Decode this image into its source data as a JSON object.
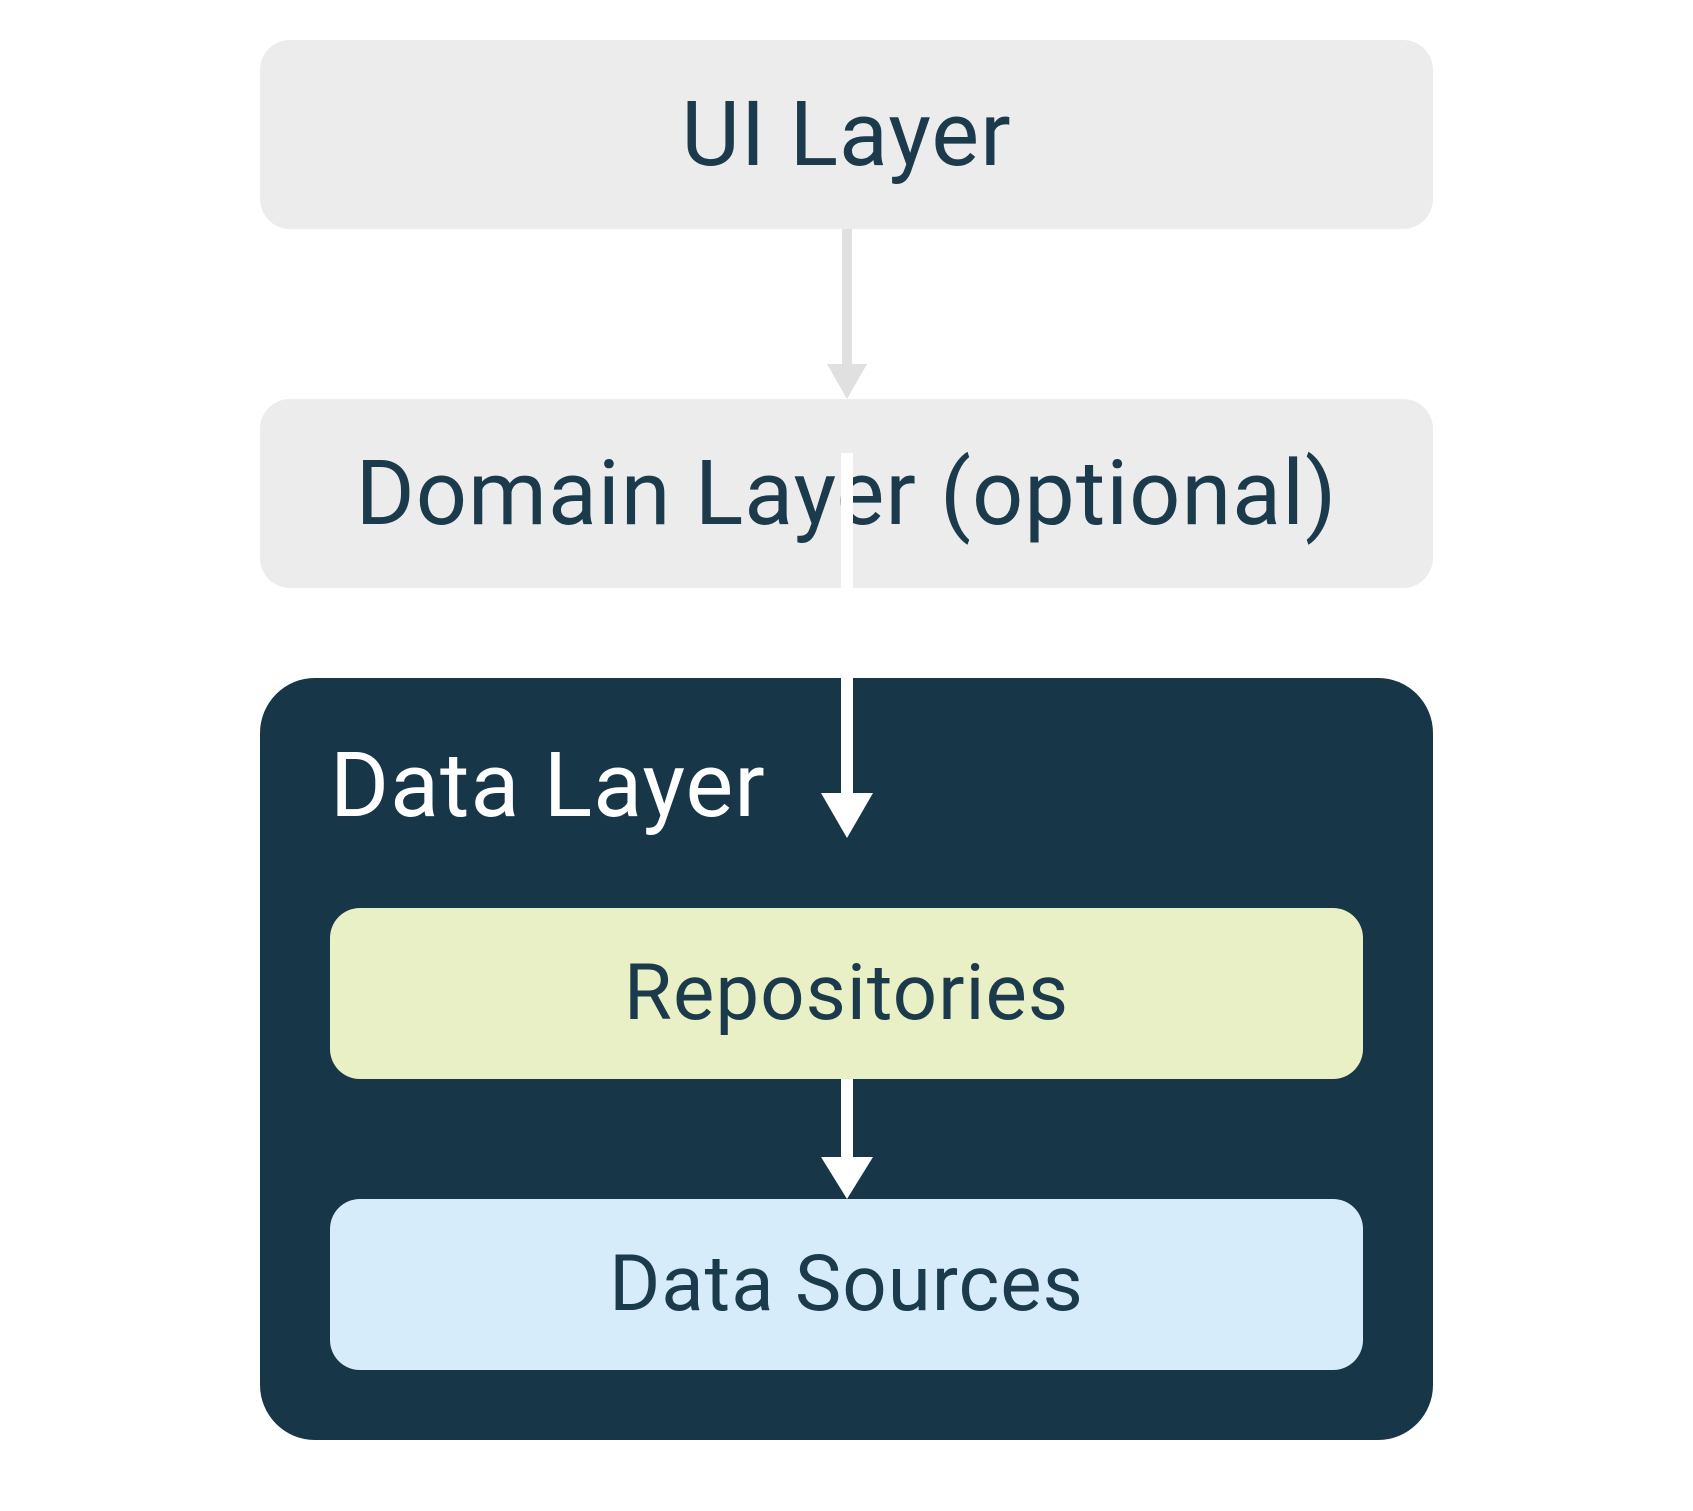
{
  "layers": {
    "ui": "UI Layer",
    "domain": "Domain Layer (optional)",
    "data": {
      "title": "Data Layer",
      "repositories": "Repositories",
      "datasources": "Data Sources"
    }
  },
  "colors": {
    "box_grey": "#ececec",
    "data_bg": "#173647",
    "repo_bg": "#eaf0c6",
    "ds_bg": "#d7ecfb",
    "text_dark": "#1b3a4b",
    "arrow_light": "#e0e0e0",
    "arrow_white": "#ffffff"
  }
}
